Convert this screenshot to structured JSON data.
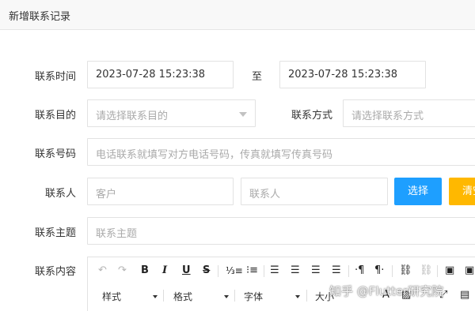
{
  "header": {
    "title": "新增联系记录"
  },
  "form": {
    "time": {
      "label": "联系时间",
      "start": "2023-07-28 15:23:38",
      "separator": "至",
      "end": "2023-07-28 15:23:38"
    },
    "purpose": {
      "label": "联系目的",
      "placeholder": "请选择联系目的"
    },
    "method": {
      "label": "联系方式",
      "placeholder": "请选择联系方式"
    },
    "number": {
      "label": "联系号码",
      "placeholder": "电话联系就填写对方电话号码，传真就填写传真号码"
    },
    "person": {
      "label": "联系人",
      "customer_placeholder": "客户",
      "contact_placeholder": "联系人",
      "select_button": "选择",
      "clear_button": "清空"
    },
    "subject": {
      "label": "联系主题",
      "placeholder": "联系主题"
    },
    "content": {
      "label": "联系内容"
    }
  },
  "editor": {
    "toolbar_row1": [
      "undo-icon",
      "redo-icon",
      "B",
      "I",
      "U",
      "S",
      "ordered-list-icon",
      "bullet-list-icon",
      "align-left-icon",
      "align-center-icon",
      "align-right-icon",
      "align-justify-icon",
      "ltr-icon",
      "rtl-icon",
      "link-icon",
      "unlink-icon",
      "image-icon"
    ],
    "style_label": "样式",
    "format_label": "格式",
    "font_label": "字体",
    "size_label": "大小"
  },
  "watermark": {
    "text": "知乎 @Flutter研究院"
  },
  "colors": {
    "accent_blue": "#1e9fff",
    "accent_orange": "#ffb800",
    "border": "#e2e2e2",
    "placeholder": "#aaaaaa"
  }
}
